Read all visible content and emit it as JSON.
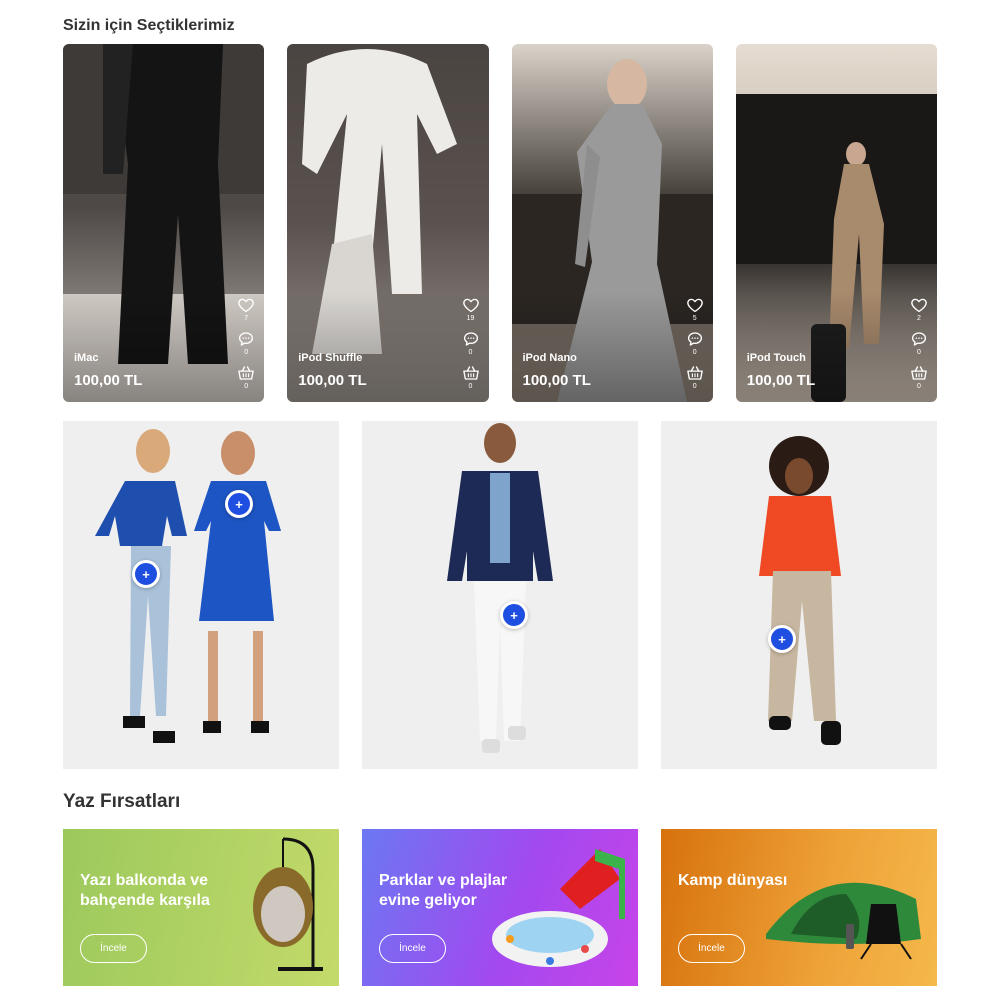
{
  "sections": {
    "picks_title": "Sizin için Seçtiklerimiz",
    "summer_title": "Yaz Fırsatları"
  },
  "stories": [
    {
      "name": "iMac",
      "price": "100,00 TL",
      "likes": "7",
      "comments": "0",
      "baskets": "0"
    },
    {
      "name": "iPod Shuffle",
      "price": "100,00 TL",
      "likes": "19",
      "comments": "0",
      "baskets": "0"
    },
    {
      "name": "iPod Nano",
      "price": "100,00 TL",
      "likes": "5",
      "comments": "0",
      "baskets": "0"
    },
    {
      "name": "iPod Touch",
      "price": "100,00 TL",
      "likes": "2",
      "comments": "0",
      "baskets": "0"
    }
  ],
  "looks": [
    {
      "hotspot_symbol": "+",
      "hotspot2_symbol": "+"
    },
    {
      "hotspot_symbol": "+"
    },
    {
      "hotspot_symbol": "+"
    }
  ],
  "banners": [
    {
      "title": "Yazı balkonda ve bahçende karşıla",
      "button": "İncele"
    },
    {
      "title": "Parklar ve plajlar evine geliyor",
      "button": "İncele"
    },
    {
      "title": "Kamp dünyası",
      "button": "İncele"
    }
  ],
  "icons": {
    "like": "heart-icon",
    "comment": "comment-icon",
    "basket": "basket-icon",
    "hotspot": "plus-icon"
  },
  "colors": {
    "hotspot": "#1f4fe0",
    "banner_green": "#9cc95c",
    "banner_purple": "#a249f0",
    "banner_orange": "#e08a22"
  }
}
